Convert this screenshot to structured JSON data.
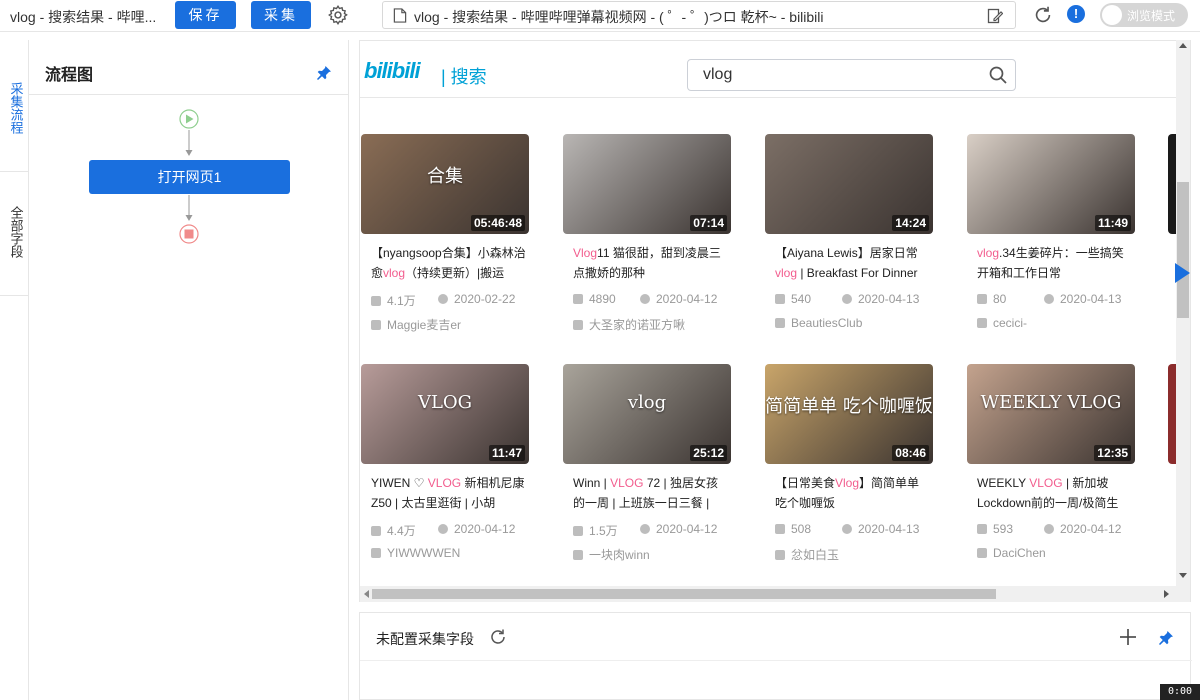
{
  "topbar": {
    "title": "vlog - 搜索结果 - 哔哩...",
    "save_label": "保存",
    "collect_label": "采集",
    "address": "vlog - 搜索结果 - 哔哩哔哩弹幕视频网 - ( ゜- ゜)つロ 乾杯~ - bilibili",
    "browse_mode_label": "浏览模式",
    "info_glyph": "!"
  },
  "side_tabs": [
    {
      "label": "采集流程",
      "active": true
    },
    {
      "label": "全部字段",
      "active": false
    }
  ],
  "flow": {
    "title": "流程图",
    "node_label": "打开网页1"
  },
  "site": {
    "logo": "bilibili",
    "section": "| 搜索",
    "search_value": "vlog"
  },
  "videos": [
    {
      "title_parts": [
        "【nyangsoop合集】小森林治愈",
        "vlog",
        "（持续更新）|搬运"
      ],
      "duration": "05:46:48",
      "plays": "4.1万",
      "date": "2020-02-22",
      "up": "Maggie麦吉er"
    },
    {
      "title_parts": [
        "",
        "Vlog",
        "11 猫很甜，甜到凌晨三点撒娇的那种"
      ],
      "duration": "07:14",
      "plays": "4890",
      "date": "2020-04-12",
      "up": "大圣家的诺亚方啾"
    },
    {
      "title_parts": [
        "【Aiyana Lewis】居家日常 ",
        "vlog",
        " | Breakfast For Dinner"
      ],
      "duration": "14:24",
      "plays": "540",
      "date": "2020-04-13",
      "up": "BeautiesClub"
    },
    {
      "title_parts": [
        "",
        "vlog",
        ".34生姜碎片：一些搞笑开箱和工作日常"
      ],
      "duration": "11:49",
      "plays": "80",
      "date": "2020-04-13",
      "up": "cecici-"
    },
    {
      "title_parts": [
        "YIWEN ♡ ",
        "VLOG",
        " 新相机尼康Z50 | 太古里逛街 | 小胡"
      ],
      "duration": "11:47",
      "plays": "4.4万",
      "date": "2020-04-12",
      "up": "YIWWWWEN"
    },
    {
      "title_parts": [
        "Winn | ",
        "VLOG",
        " 72 | 独居女孩的一周 | 上班族一日三餐 |"
      ],
      "duration": "25:12",
      "plays": "1.5万",
      "date": "2020-04-12",
      "up": "一块肉winn"
    },
    {
      "title_parts": [
        "【日常美食",
        "Vlog",
        "】简简单单吃个咖喱饭"
      ],
      "duration": "08:46",
      "plays": "508",
      "date": "2020-04-13",
      "up": "忿如白玉"
    },
    {
      "title_parts": [
        "WEEKLY ",
        "VLOG",
        " | 新加坡Lockdown前的一周/极简生"
      ],
      "duration": "12:35",
      "plays": "593",
      "date": "2020-04-12",
      "up": "DaciChen"
    }
  ],
  "thumb_overlays": [
    "合集",
    "",
    "",
    "",
    "VLOG",
    "vlog",
    "简简单单 吃个咖喱饭",
    "WEEKLY VLOG"
  ],
  "thumb_colors": [
    "#8a6d55",
    "#b9b6b4",
    "#7c6f66",
    "#d9cfc6",
    "#b89c9a",
    "#a9a49b",
    "#c9a56a",
    "#c4a38e"
  ],
  "fields": {
    "title": "未配置采集字段"
  },
  "timer": "0:00",
  "colors": {
    "accent": "#1a6fde",
    "bili_blue": "#00a1d6",
    "highlight": "#f25d8e"
  }
}
